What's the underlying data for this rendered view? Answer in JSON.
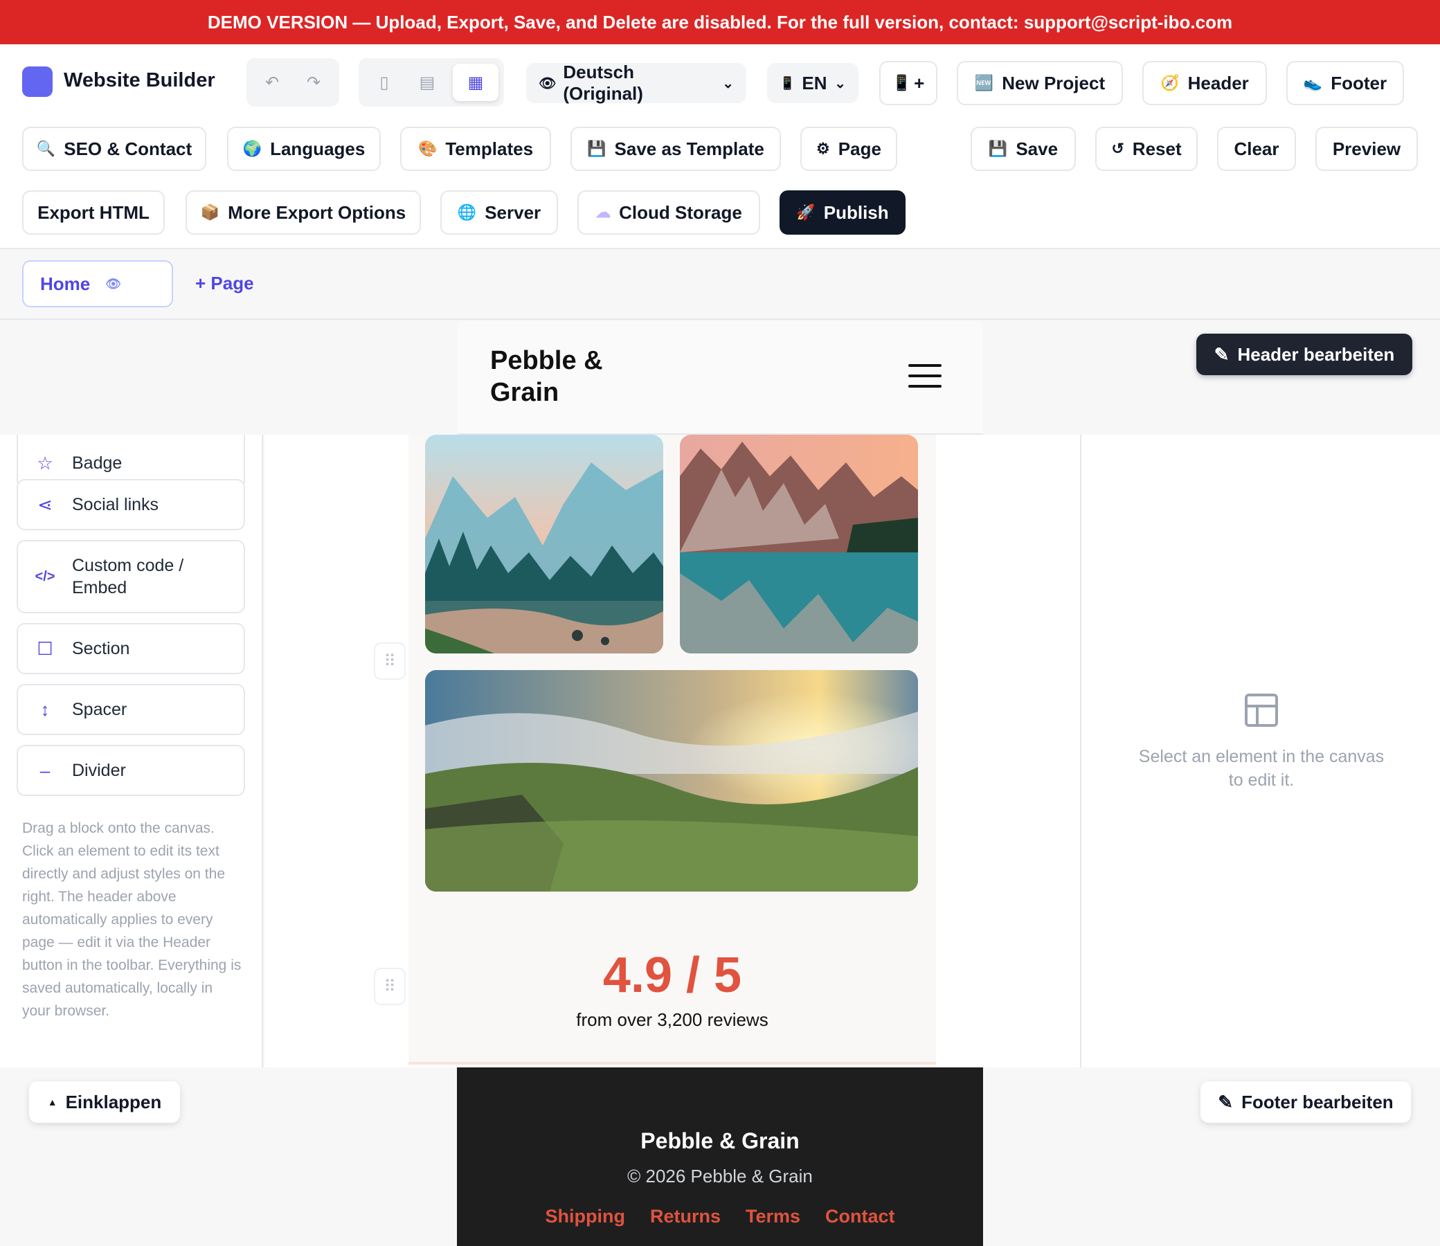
{
  "banner": {
    "text": "DEMO VERSION — Upload, Export, Save, and Delete are disabled. For the full version, contact: support@script-ibo.com"
  },
  "app": {
    "title": "Website Builder"
  },
  "toolbar": {
    "language_select": "Deutsch (Original)",
    "locale_select": "EN",
    "add_language": "+",
    "new_project": "New Project",
    "header": "Header",
    "footer": "Footer",
    "seo_contact": "SEO & Contact",
    "languages": "Languages",
    "templates": "Templates",
    "save_as_template": "Save as Template",
    "page": "Page",
    "save": "Save",
    "reset": "Reset",
    "clear": "Clear",
    "preview": "Preview",
    "export_html": "Export HTML",
    "more_export": "More Export Options",
    "server": "Server",
    "cloud_storage": "Cloud Storage",
    "publish": "Publish"
  },
  "icons": {
    "undo": "↶",
    "redo": "↷",
    "device_desktop": "▯",
    "device_tablet": "▤",
    "device_mobile": "▦",
    "eye": "👁",
    "phone": "📱",
    "new": "🆕",
    "compass": "🧭",
    "footprint": "👟",
    "search": "🔍",
    "globe": "🌍",
    "palette": "🎨",
    "disk": "💾",
    "gear": "⚙",
    "reset": "↺",
    "box": "📦",
    "server": "🌐",
    "cloud": "☁",
    "rocket": "🚀",
    "pencil": "✎",
    "star": "☆",
    "share": "⋖",
    "code": "</>",
    "section": "☐",
    "spacer": "↕",
    "divider": "–",
    "drag": "⠿",
    "caret_up": "▲"
  },
  "pages": {
    "home": "Home",
    "add": "+ Page"
  },
  "site": {
    "brand": "Pebble & Grain",
    "edit_header": "Header bearbeiten",
    "edit_footer": "Footer bearbeiten",
    "collapse": "Einklappen"
  },
  "blocks": [
    {
      "label": "Badge"
    },
    {
      "label": "Social links"
    },
    {
      "label": "Custom code / Embed"
    },
    {
      "label": "Section"
    },
    {
      "label": "Spacer"
    },
    {
      "label": "Divider"
    }
  ],
  "help_text": "Drag a block onto the canvas. Click an element to edit its text directly and adjust styles on the right. The header above automatically applies to every page — edit it via the Header button in the toolbar. Everything is saved automatically, locally in your browser.",
  "stats": {
    "rating": "4.9 / 5",
    "subtitle": "from over 3,200 reviews"
  },
  "inspector": {
    "empty": "Select an element in the canvas to edit it."
  },
  "footer": {
    "brand": "Pebble & Grain",
    "copyright": "© 2026 Pebble & Grain",
    "links": [
      "Shipping",
      "Returns",
      "Terms",
      "Contact"
    ]
  },
  "colors": {
    "accent": "#4f46e5",
    "danger": "#dc2626",
    "brand_red": "#e0533f",
    "dark": "#111827"
  }
}
